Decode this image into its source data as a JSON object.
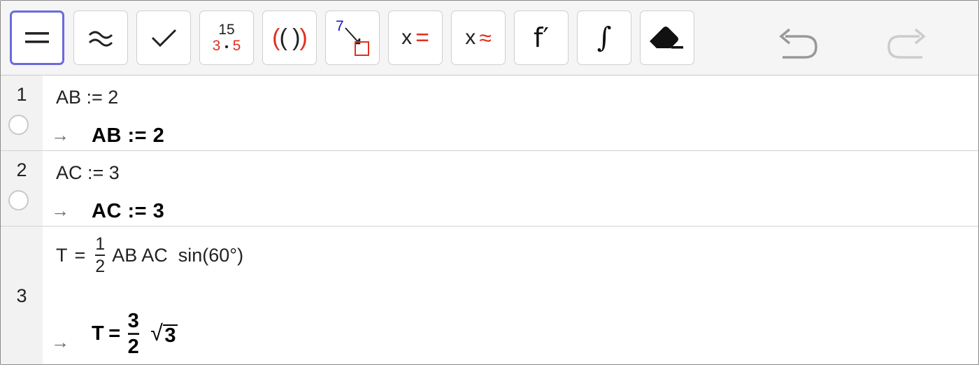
{
  "toolbar": {
    "buttons": [
      {
        "name": "evaluate-button",
        "selected": true
      },
      {
        "name": "numeric-button"
      },
      {
        "name": "keep-input-button"
      },
      {
        "name": "factor-button",
        "top": "15",
        "bottom_a": "3",
        "bottom_b": "5"
      },
      {
        "name": "expand-button",
        "text": "(( ))"
      },
      {
        "name": "substitute-button",
        "digit": "7"
      },
      {
        "name": "solve-button",
        "var": "x",
        "sym": "="
      },
      {
        "name": "solve-numerically-button",
        "var": "x",
        "sym": "≈"
      },
      {
        "name": "derivative-button",
        "text": "f′"
      },
      {
        "name": "integral-button",
        "text": "∫"
      },
      {
        "name": "delete-button"
      }
    ],
    "factor_top": "15",
    "factor_a": "3",
    "factor_dot": "•",
    "factor_b": "5",
    "expand_text": "(( ))",
    "substitute_digit": "7",
    "solve_var": "x",
    "solve_sym": "=",
    "nsolve_var": "x",
    "nsolve_sym": "≈",
    "derivative_text": "f′",
    "integral_text": "∫"
  },
  "colors": {
    "accent": "#6a6adf",
    "red": "#e0301e",
    "blue": "#1515c8",
    "gray": "#999999"
  },
  "rows": [
    {
      "num": "1",
      "input": "AB := 2",
      "output": "AB := 2"
    },
    {
      "num": "2",
      "input": "AC := 3",
      "output": "AC := 3"
    },
    {
      "num": "3",
      "input_lhs": "T",
      "input_eq": "=",
      "input_num": "1",
      "input_den": "2",
      "input_rest": "AB AC  sin(60°)",
      "output_lhs": "T",
      "output_eq": "=",
      "output_num": "3",
      "output_den": "2",
      "output_sqrt": "3"
    }
  ],
  "arrow": "→"
}
